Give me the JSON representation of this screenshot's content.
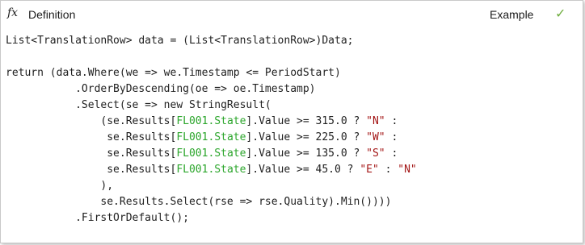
{
  "header": {
    "fx_symbol": "fx",
    "title": "Definition",
    "example_label": "Example",
    "check_symbol": "✓",
    "icons": [
      "fx-icon",
      "check-icon"
    ]
  },
  "colors": {
    "string": "#a31515",
    "field": "#2aa52a",
    "check": "#6fae3f"
  },
  "code": {
    "lines": [
      [
        {
          "t": "List<TranslationRow> data = (List<TranslationRow>)Data;"
        }
      ],
      [
        {
          "t": ""
        }
      ],
      [
        {
          "t": "return (data.Where(we => we.Timestamp <= PeriodStart)"
        }
      ],
      [
        {
          "t": "           .OrderByDescending(oe => oe.Timestamp)"
        }
      ],
      [
        {
          "t": "           .Select(se => new StringResult("
        }
      ],
      [
        {
          "t": "               (se.Results["
        },
        {
          "t": "FL001.State",
          "k": "field"
        },
        {
          "t": "].Value >= 315.0 ? "
        },
        {
          "t": "\"N\"",
          "k": "str"
        },
        {
          "t": " :"
        }
      ],
      [
        {
          "t": "                se.Results["
        },
        {
          "t": "FL001.State",
          "k": "field"
        },
        {
          "t": "].Value >= 225.0 ? "
        },
        {
          "t": "\"W\"",
          "k": "str"
        },
        {
          "t": " :"
        }
      ],
      [
        {
          "t": "                se.Results["
        },
        {
          "t": "FL001.State",
          "k": "field"
        },
        {
          "t": "].Value >= 135.0 ? "
        },
        {
          "t": "\"S\"",
          "k": "str"
        },
        {
          "t": " :"
        }
      ],
      [
        {
          "t": "                se.Results["
        },
        {
          "t": "FL001.State",
          "k": "field"
        },
        {
          "t": "].Value >= 45.0 ? "
        },
        {
          "t": "\"E\"",
          "k": "str"
        },
        {
          "t": " : "
        },
        {
          "t": "\"N\"",
          "k": "str"
        }
      ],
      [
        {
          "t": "               ),"
        }
      ],
      [
        {
          "t": "               se.Results.Select(rse => rse.Quality).Min())))"
        }
      ],
      [
        {
          "t": "           .FirstOrDefault();"
        }
      ]
    ]
  }
}
